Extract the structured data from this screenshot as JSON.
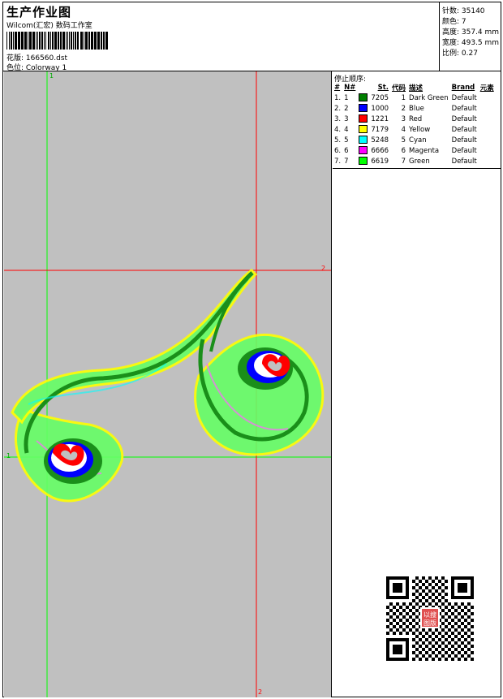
{
  "header": {
    "title": "生产作业图",
    "company": "Wilcom(汇宏) 数码工作室",
    "design_file": "花版: 166560.dst",
    "colorway": "色位: Colorway 1"
  },
  "stats": {
    "stitches": "针数: 35140",
    "colors": "颜色: 7",
    "height": "高度: 357.4 mm",
    "width": "宽度: 493.5 mm",
    "scale": "比例: 0.27"
  },
  "canvas": {
    "background": "#c0c0c0",
    "axis_labels": {
      "v1": "1",
      "h1": "1",
      "h2": "2",
      "v2": "2"
    },
    "colors": {
      "green_axis": "#00ff00",
      "red_axis": "#ff0000"
    }
  },
  "stop_sequence": {
    "title": "停止顺序:",
    "headers": [
      "#",
      "N#",
      "St.",
      "代码",
      "描述",
      "Brand",
      "元素"
    ],
    "rows": [
      {
        "idx": "1.",
        "n": "1",
        "code": "7205",
        "stop": "1",
        "desc": "Dark Green",
        "brand": "Default",
        "color": "#007f00"
      },
      {
        "idx": "2.",
        "n": "2",
        "code": "1000",
        "stop": "2",
        "desc": "Blue",
        "brand": "Default",
        "color": "#0000ff"
      },
      {
        "idx": "3.",
        "n": "3",
        "code": "1221",
        "stop": "3",
        "desc": "Red",
        "brand": "Default",
        "color": "#ff0000"
      },
      {
        "idx": "4.",
        "n": "4",
        "code": "7179",
        "stop": "4",
        "desc": "Yellow",
        "brand": "Default",
        "color": "#ffff00"
      },
      {
        "idx": "5.",
        "n": "5",
        "code": "5248",
        "stop": "5",
        "desc": "Cyan",
        "brand": "Default",
        "color": "#00ffff"
      },
      {
        "idx": "6.",
        "n": "6",
        "code": "6666",
        "stop": "6",
        "desc": "Magenta",
        "brand": "Default",
        "color": "#ff00ff"
      },
      {
        "idx": "7.",
        "n": "7",
        "code": "6619",
        "stop": "7",
        "desc": "Green",
        "brand": "Default",
        "color": "#00ff00"
      }
    ]
  },
  "qr": {
    "stamp_text": "以图搜版"
  }
}
